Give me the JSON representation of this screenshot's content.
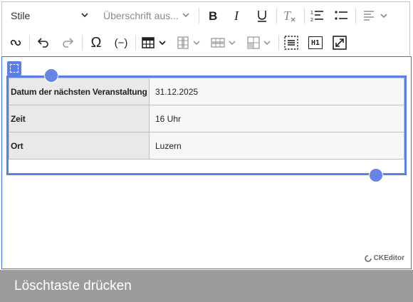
{
  "toolbar": {
    "style_dropdown": {
      "label": "Stile"
    },
    "heading_dropdown": {
      "label": "Überschrift aus..."
    },
    "buttons_row1": [
      "bold-icon",
      "italic-icon",
      "underline-icon",
      "remove-format-icon",
      "numbered-list-icon",
      "bulleted-list-icon",
      "align-left-icon"
    ],
    "buttons_row2": [
      "link-icon",
      "undo-icon",
      "redo-icon",
      "special-characters-icon",
      "placeholder-icon",
      "table-icon",
      "table-column-icon",
      "table-row-icon",
      "merge-cells-icon",
      "page-break-icon",
      "heading-h1-icon",
      "fullscreen-icon"
    ],
    "heading_h1_text": "H1",
    "omega_symbol": "Ω",
    "placeholder_text": "(−)"
  },
  "table": {
    "rows": [
      {
        "key": "Datum der nächsten Veranstaltung",
        "value": "31.12.2025"
      },
      {
        "key": "Zeit",
        "value": "16 Uhr"
      },
      {
        "key": "Ort",
        "value": "Luzern"
      }
    ]
  },
  "powered_by": "CKEditor",
  "caption": "Löschtaste drücken",
  "colors": {
    "accent": "#5b7fe3",
    "caption_bg": "#9b9b9b",
    "header_cell_bg": "#e9e9e9"
  }
}
